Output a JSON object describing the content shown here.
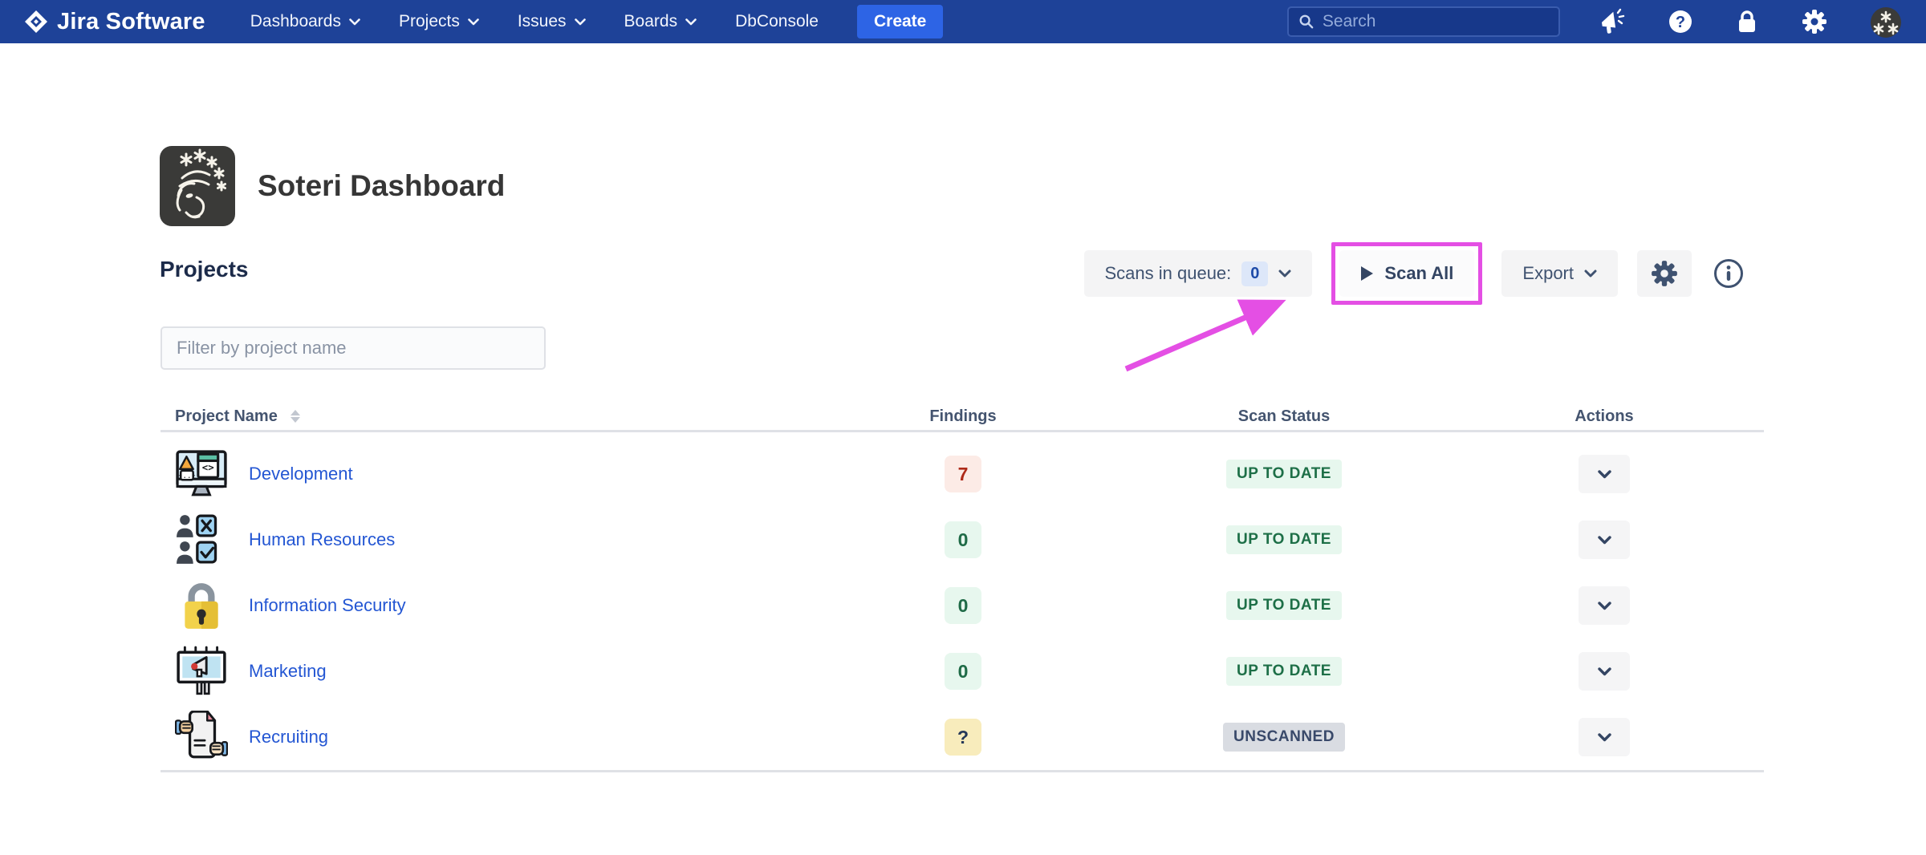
{
  "navbar": {
    "brand": "Jira Software",
    "items": [
      {
        "label": "Dashboards",
        "has_dropdown": true
      },
      {
        "label": "Projects",
        "has_dropdown": true
      },
      {
        "label": "Issues",
        "has_dropdown": true
      },
      {
        "label": "Boards",
        "has_dropdown": true
      },
      {
        "label": "DbConsole",
        "has_dropdown": false
      }
    ],
    "create_label": "Create",
    "search_placeholder": "Search",
    "icons": [
      "search-icon",
      "megaphone-icon",
      "help-icon",
      "lock-icon",
      "gear-icon",
      "avatar"
    ],
    "colors": {
      "background": "#1e4298",
      "create_button": "#2d64e5"
    }
  },
  "header": {
    "title": "Soteri Dashboard",
    "logo_icon": "soteri-face-with-stars"
  },
  "projects": {
    "heading": "Projects",
    "filter_placeholder": "Filter by project name"
  },
  "toolbar": {
    "scans_in_queue_label": "Scans in queue:",
    "scans_in_queue_count": "0",
    "scan_all_label": "Scan All",
    "export_label": "Export",
    "icons": [
      "play-icon",
      "chevron-down-icon",
      "gear-icon",
      "info-icon"
    ],
    "annotation": {
      "shape": "highlight-box-with-arrow",
      "target": "Scan All",
      "color": "#e44fe4"
    }
  },
  "table": {
    "columns": [
      "Project Name",
      "Findings",
      "Scan Status",
      "Actions"
    ],
    "rows": [
      {
        "name": "Development",
        "icon": "computer-code-icon",
        "findings": "7",
        "findings_level": "error",
        "status": "UP TO DATE",
        "status_level": "ok"
      },
      {
        "name": "Human Resources",
        "icon": "people-checklist-icon",
        "findings": "0",
        "findings_level": "ok",
        "status": "UP TO DATE",
        "status_level": "ok"
      },
      {
        "name": "Information Security",
        "icon": "padlock-icon",
        "findings": "0",
        "findings_level": "ok",
        "status": "UP TO DATE",
        "status_level": "ok"
      },
      {
        "name": "Marketing",
        "icon": "billboard-icon",
        "findings": "0",
        "findings_level": "ok",
        "status": "UP TO DATE",
        "status_level": "ok"
      },
      {
        "name": "Recruiting",
        "icon": "document-hands-icon",
        "findings": "?",
        "findings_level": "unknown",
        "status": "UNSCANNED",
        "status_level": "none"
      }
    ]
  },
  "colors": {
    "link_blue": "#2356d3",
    "badge_red_bg": "#fcebe6",
    "badge_red_text": "#ae2a19",
    "badge_green_bg": "#e7f7ee",
    "badge_green_text": "#1f6b47",
    "badge_yellow_bg": "#f8ecbc",
    "badge_gray_bg": "#d9dce2",
    "annotation_magenta": "#e44fe4"
  }
}
